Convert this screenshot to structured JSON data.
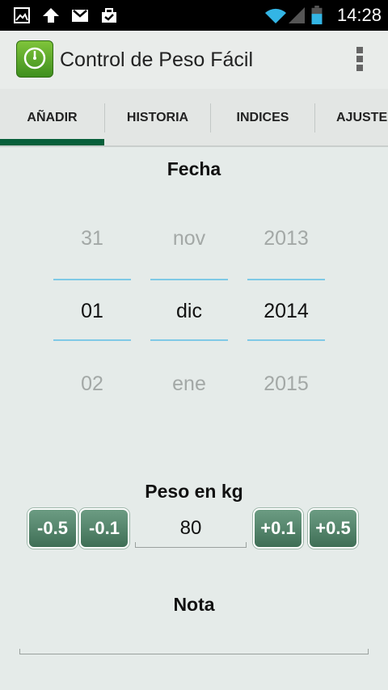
{
  "status_bar": {
    "time": "14:28",
    "icons": [
      "image-icon",
      "upload-icon",
      "gmail-icon",
      "briefcase-check-icon",
      "wifi-icon",
      "signal-icon",
      "battery-icon"
    ]
  },
  "app_bar": {
    "title": "Control de Peso Fácil",
    "icon": "scale-icon",
    "menu_icon": "overflow-menu-icon"
  },
  "tabs": [
    {
      "label": "AÑADIR",
      "selected": true
    },
    {
      "label": "HISTORIA",
      "selected": false
    },
    {
      "label": "INDICES",
      "selected": false
    },
    {
      "label": "AJUSTE",
      "selected": false
    }
  ],
  "date_section": {
    "title": "Fecha",
    "day": {
      "prev": "31",
      "value": "01",
      "next": "02"
    },
    "month": {
      "prev": "nov",
      "value": "dic",
      "next": "ene"
    },
    "year": {
      "prev": "2013",
      "value": "2014",
      "next": "2015"
    }
  },
  "weight_section": {
    "title": "Peso en kg",
    "value": "80",
    "buttons": {
      "minus_half": "-0.5",
      "minus_tenth": "-0.1",
      "plus_tenth": "+0.1",
      "plus_half": "+0.5"
    }
  },
  "note_section": {
    "title": "Nota",
    "value": ""
  },
  "colors": {
    "background": "#e5ebe9",
    "tab_indicator": "#075f3a",
    "button_green": "#4f806a",
    "picker_line": "#7fc9e6"
  }
}
